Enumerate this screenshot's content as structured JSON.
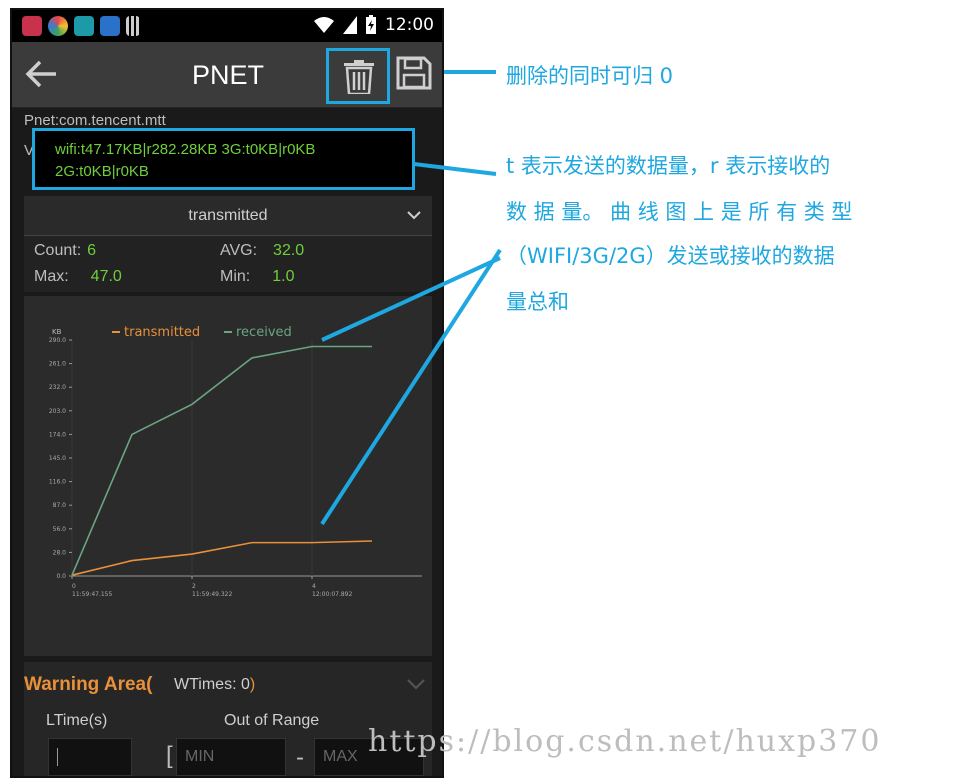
{
  "statusbar": {
    "time": "12:00"
  },
  "appbar": {
    "title": "PNET"
  },
  "pkg": "Pnet:com.tencent.mtt",
  "val": {
    "label": "Val:",
    "line1": "wifi:t47.17KB|r282.28KB 3G:t0KB|r0KB",
    "line2": "2G:t0KB|r0KB"
  },
  "dropdown": {
    "selected": "transmitted"
  },
  "stats": {
    "count_label": "Count:",
    "count": "6",
    "avg_label": "AVG:",
    "avg": "32.0",
    "max_label": "Max:",
    "max": "47.0",
    "min_label": "Min:",
    "min": "1.0"
  },
  "chart_data": {
    "type": "line",
    "unit": "KB",
    "legend": [
      "transmitted",
      "received"
    ],
    "x_ticks": [
      {
        "num": "0",
        "time": "11:59:47.155"
      },
      {
        "num": "2",
        "time": "11:59:49.322"
      },
      {
        "num": "4",
        "time": "12:00:07.892"
      }
    ],
    "y_ticks": [
      "0.0",
      "28.0",
      "56.0",
      "87.0",
      "116.0",
      "145.0",
      "174.0",
      "203.0",
      "232.0",
      "261.0",
      "290.0"
    ],
    "ylim": [
      0,
      290
    ],
    "xlim": [
      0,
      5
    ],
    "series": [
      {
        "name": "transmitted",
        "color": "#e8903a",
        "x": [
          0,
          1,
          2,
          3,
          4,
          5
        ],
        "y": [
          1,
          19,
          27,
          41,
          41,
          43
        ]
      },
      {
        "name": "received",
        "color": "#6aa581",
        "x": [
          0,
          1,
          2,
          3,
          4,
          5
        ],
        "y": [
          1,
          174,
          211,
          268,
          282,
          282
        ]
      }
    ]
  },
  "warning": {
    "title": "Warning Area(",
    "wtimes": "WTimes: 0",
    "close_paren": ")",
    "ltime_label": "LTime(s)",
    "oor_label": "Out of Range",
    "min_placeholder": "MIN",
    "max_placeholder": "MAX"
  },
  "annotations": {
    "delete": "删除的同时可归 0",
    "desc_line1": "t 表示发送的数据量，r 表示接收的",
    "desc_line2": "数 据 量。 曲 线 图 上 是 所 有 类 型",
    "desc_line3": "（WIFI/3G/2G）发送或接收的数据",
    "desc_line4": "量总和"
  },
  "watermark": "https://blog.csdn.net/huxp370",
  "colors": {
    "accent": "#1ea7e0",
    "green": "#6fcf3b",
    "orange": "#e8903a"
  }
}
